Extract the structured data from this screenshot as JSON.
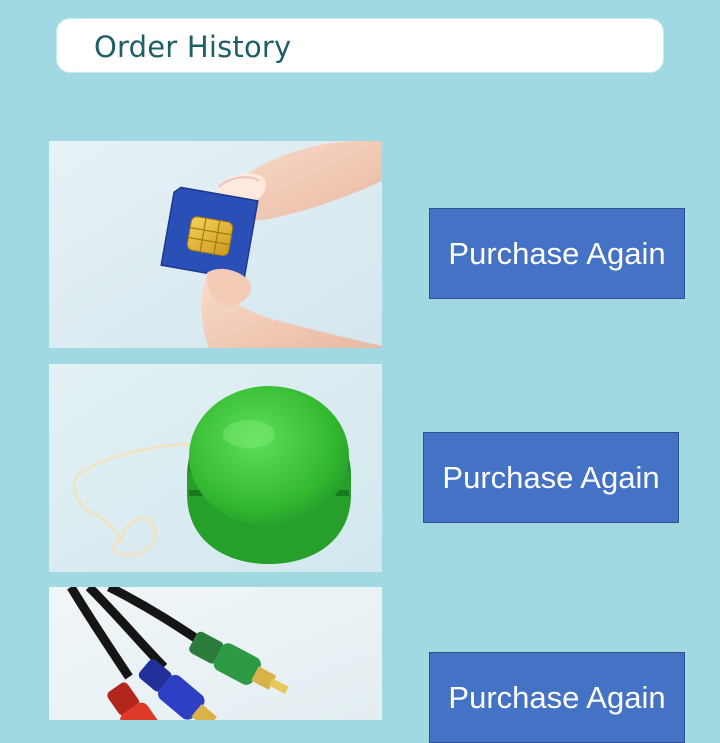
{
  "header": {
    "title": "Order History"
  },
  "orders": [
    {
      "item_image": "sim-card-image",
      "action_label": "Purchase Again"
    },
    {
      "item_image": "green-yoyo-image",
      "action_label": "Purchase Again"
    },
    {
      "item_image": "rca-component-cable-image",
      "action_label": "Purchase Again"
    }
  ],
  "colors": {
    "background": "#a0d9e1",
    "button": "#4472c4",
    "button_border": "#2f528f",
    "header_text": "#1e5e66"
  }
}
